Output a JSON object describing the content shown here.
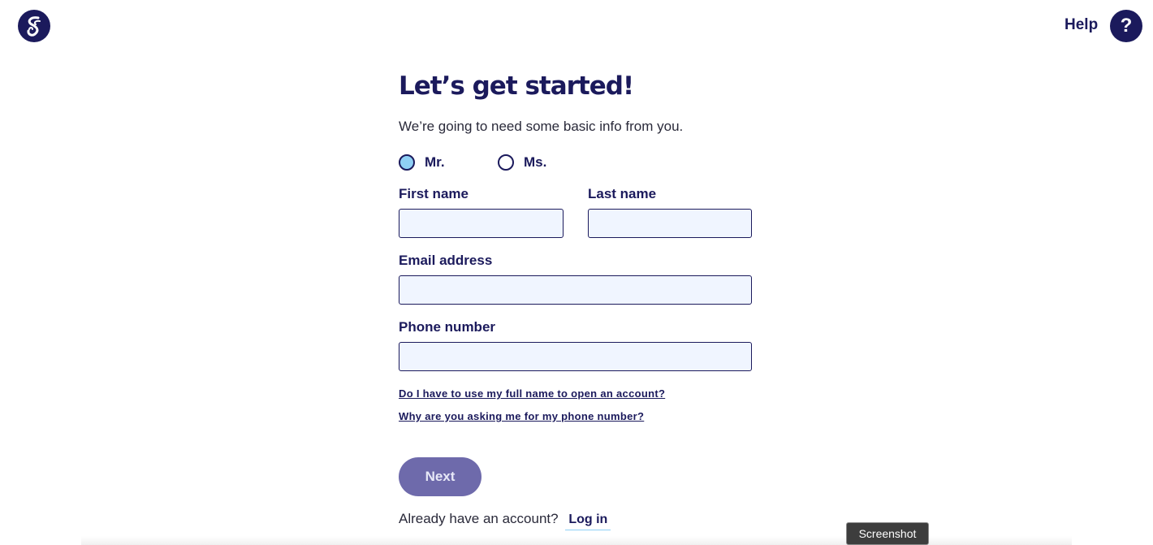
{
  "header": {
    "logo_icon": "brand-logo-icon",
    "help_label": "Help",
    "help_icon_glyph": "?"
  },
  "form": {
    "title": "Let’s get started!",
    "subtitle": "We’re going to need some basic info from you.",
    "salutation": {
      "options": [
        {
          "label": "Mr.",
          "selected": true
        },
        {
          "label": "Ms.",
          "selected": false
        }
      ]
    },
    "first_name": {
      "label": "First name",
      "value": ""
    },
    "last_name": {
      "label": "Last name",
      "value": ""
    },
    "email": {
      "label": "Email address",
      "value": ""
    },
    "phone": {
      "label": "Phone number",
      "value": ""
    },
    "faq_links": [
      "Do I have to use my full name to open an account?",
      "Why are you asking me for my phone number?"
    ],
    "next_label": "Next",
    "login_prompt": "Already have an account?",
    "login_label": "Log in"
  },
  "overlay": {
    "badge": "Screenshot"
  },
  "colors": {
    "navy": "#1b1a5c",
    "input_bg": "#f0f5ff",
    "radio_checked": "#8fd0f5",
    "button_bg": "#6e6aab"
  }
}
